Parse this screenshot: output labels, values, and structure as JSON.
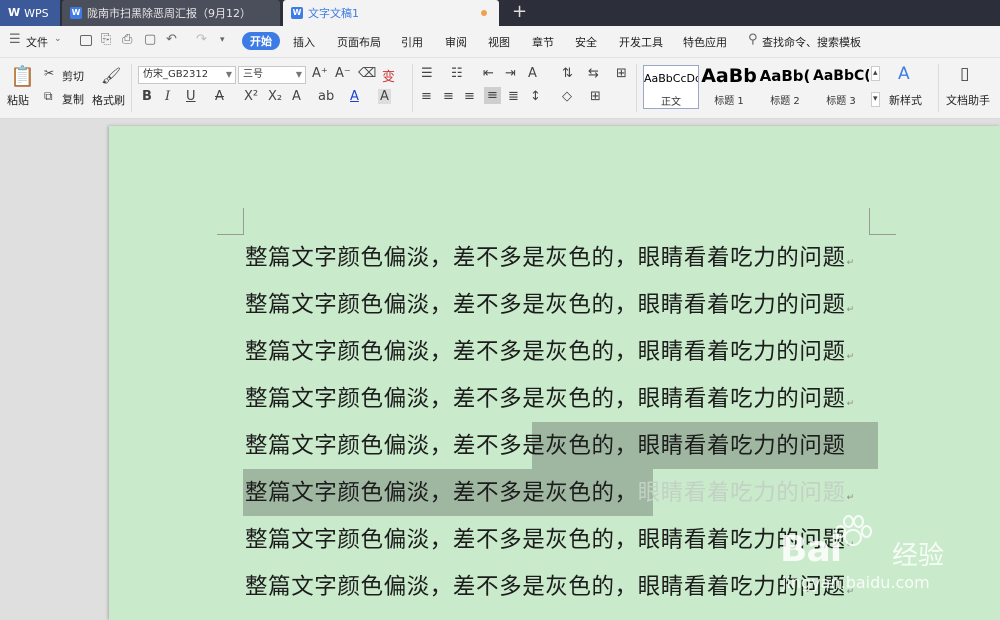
{
  "tabs": {
    "app": "WPS",
    "doc1": "陇南市扫黑除恶周汇报（9月12）",
    "doc2": "文字文稿1",
    "new_tab": "+"
  },
  "menu": {
    "file": "文件",
    "items": [
      "开始",
      "插入",
      "页面布局",
      "引用",
      "审阅",
      "视图",
      "章节",
      "安全",
      "开发工具",
      "特色应用"
    ],
    "search": "查找命令、搜索模板"
  },
  "ribbon": {
    "paste": "粘贴",
    "cut": "剪切",
    "copy": "复制",
    "format_painter": "格式刷",
    "font_name": "仿宋_GB2312",
    "font_size": "三号",
    "styles": [
      {
        "sample": "AaBbCcDd",
        "label": "正文"
      },
      {
        "sample": "AaBb",
        "label": "标题 1"
      },
      {
        "sample": "AaBb(",
        "label": "标题 2"
      },
      {
        "sample": "AaBbC(",
        "label": "标题 3"
      }
    ],
    "new_style": "新样式",
    "doc_assistant": "文档助手"
  },
  "document": {
    "lines": [
      "整篇文字颜色偏淡，差不多是灰色的，眼睛看着吃力的问题",
      "整篇文字颜色偏淡，差不多是灰色的，眼睛看着吃力的问题",
      "整篇文字颜色偏淡，差不多是灰色的，眼睛看着吃力的问题",
      "整篇文字颜色偏淡，差不多是灰色的，眼睛看着吃力的问题"
    ],
    "line5": {
      "normal": "整篇文字颜色偏淡，差不多",
      "selected": "是灰色的，眼睛看着吃力的问题"
    },
    "line6": {
      "selected": "整篇文字颜色偏淡，差不多是灰色的，",
      "faded": "眼睛看着吃力的问题"
    },
    "line7": "整篇文字颜色偏淡，差不多是灰色的，眼睛看着吃力的问题",
    "line8": "整篇文字颜色偏淡，差不多是灰色的，眼睛看着吃力的问题",
    "paragraph_mark": "↵"
  },
  "watermark": {
    "brand": "Bai",
    "cn": "经验",
    "url": "jingyan.baidu.com"
  },
  "colors": {
    "page_bg": "#c9eacb",
    "selection": "#9fb6a1",
    "accent": "#3d7be5"
  }
}
